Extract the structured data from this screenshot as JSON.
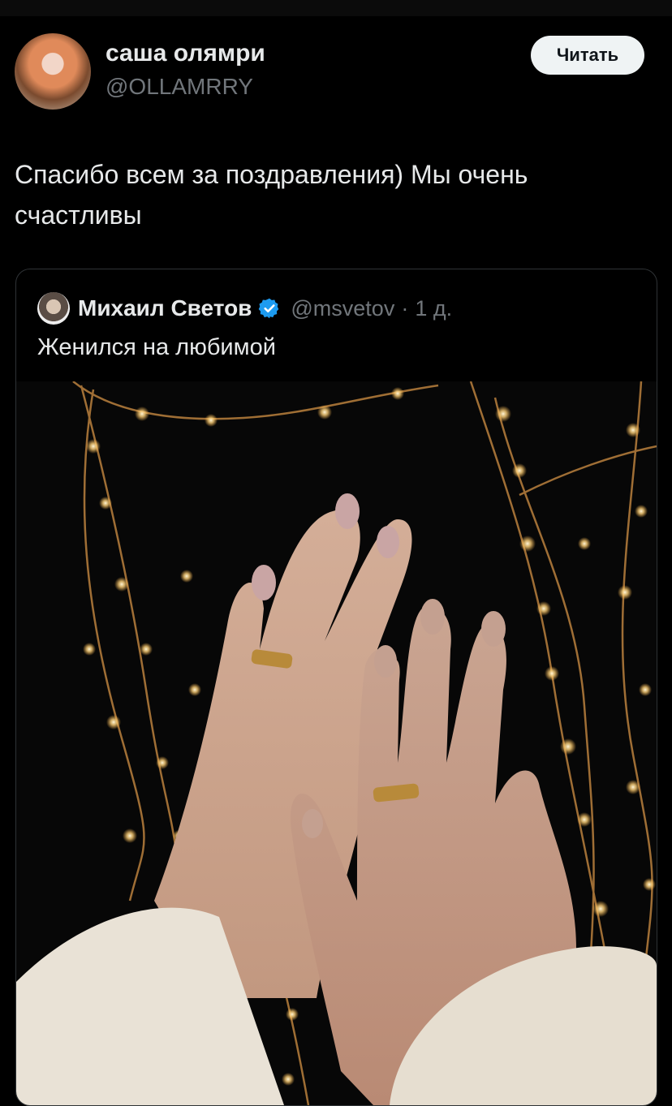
{
  "post": {
    "author_name": "саша олямри",
    "author_handle": "@OLLAMRRY",
    "follow_label": "Читать",
    "text": "Спасибо всем за поздравления) Мы очень счастливы"
  },
  "quote": {
    "author_name": "Михаил Светов",
    "author_handle": "@msvetov",
    "separator": "·",
    "time": "1 д.",
    "text": "Женился на любимой",
    "verified_color": "#1d9bf0"
  },
  "icons": {
    "verified": "verified-badge-icon"
  }
}
